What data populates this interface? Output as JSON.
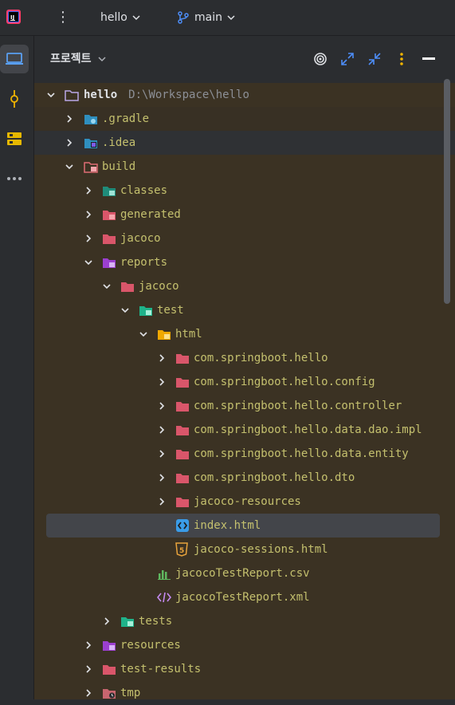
{
  "topbar": {
    "project_name": "hello",
    "branch_name": "main"
  },
  "panel": {
    "title": "프로젝트"
  },
  "tree": {
    "root": {
      "name": "hello",
      "path": "D:\\Workspace\\hello"
    },
    "items": [
      {
        "label": ".gradle"
      },
      {
        "label": ".idea"
      },
      {
        "label": "build"
      },
      {
        "label": "classes"
      },
      {
        "label": "generated"
      },
      {
        "label": "jacoco"
      },
      {
        "label": "reports"
      },
      {
        "label": "jacoco"
      },
      {
        "label": "test"
      },
      {
        "label": "html"
      },
      {
        "label": "com.springboot.hello"
      },
      {
        "label": "com.springboot.hello.config"
      },
      {
        "label": "com.springboot.hello.controller"
      },
      {
        "label": "com.springboot.hello.data.dao.impl"
      },
      {
        "label": "com.springboot.hello.data.entity"
      },
      {
        "label": "com.springboot.hello.dto"
      },
      {
        "label": "jacoco-resources"
      },
      {
        "label": "index.html"
      },
      {
        "label": "jacoco-sessions.html"
      },
      {
        "label": "jacocoTestReport.csv"
      },
      {
        "label": "jacocoTestReport.xml"
      },
      {
        "label": "tests"
      },
      {
        "label": "resources"
      },
      {
        "label": "test-results"
      },
      {
        "label": "tmp"
      }
    ]
  },
  "colors": {
    "accent": "#3574f0",
    "tree_text": "#c4c06e",
    "folder_red": "#e06c75",
    "tree_bg": "#3b3223"
  },
  "icons": {
    "topbar": [
      "intellij-logo-icon",
      "kebab-menu-icon",
      "chevron-down-icon",
      "git-branch-icon"
    ],
    "leftbar": [
      "project-icon",
      "commit-icon",
      "structure-icon",
      "more-icon"
    ],
    "header": [
      "locate-icon",
      "expand-all-icon",
      "collapse-all-icon",
      "options-icon",
      "hide-icon"
    ]
  }
}
